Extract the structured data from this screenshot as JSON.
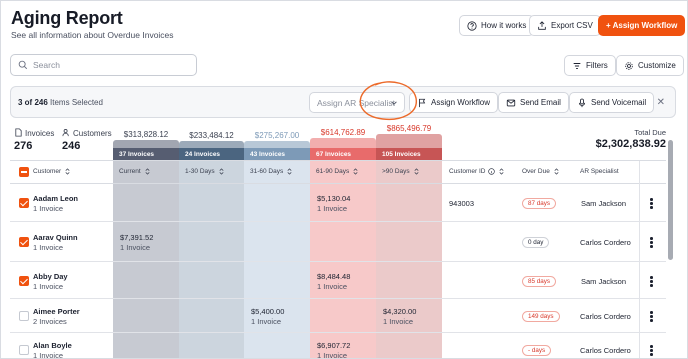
{
  "header": {
    "title": "Aging Report",
    "subtitle": "See all information about Overdue Invoices",
    "how_it_works": "How it works",
    "export_csv": "Export CSV",
    "assign_workflow": "+ Assign Workflow"
  },
  "search": {
    "placeholder": "Search"
  },
  "filters": {
    "filters_label": "Filters",
    "customize_label": "Customize"
  },
  "selection": {
    "count": "3 of 246",
    "suffix": "Items Selected",
    "ar_specialist_placeholder": "Assign AR Specialist",
    "assign_workflow": "Assign Workflow",
    "send_email": "Send Email",
    "send_voicemail": "Send Voicemail"
  },
  "stats": {
    "invoices_label": "Invoices",
    "invoices_value": "276",
    "customers_label": "Customers",
    "customers_value": "246",
    "total_due_label": "Total Due",
    "total_due_value": "$2,302,838.92"
  },
  "buckets": [
    {
      "amount": "$313,828.12",
      "invoices": "37 Invoices",
      "header": "Current",
      "color": "#565d71",
      "fill": "#c7cad2"
    },
    {
      "amount": "$233,484.12",
      "invoices": "24 Invoices",
      "header": "1-30 Days",
      "color": "#4b6580",
      "fill": "#ccd5de"
    },
    {
      "amount": "$275,267.00",
      "invoices": "43 Invoices",
      "header": "31-60 Days",
      "color": "#7d9ab7",
      "fill": "#dbe4ee"
    },
    {
      "amount": "$614,762.89",
      "invoices": "67 Invoices",
      "header": "61-90 Days",
      "color": "#e86b6b",
      "fill": "#f7c9c9"
    },
    {
      "amount": "$865,496.79",
      "invoices": "105 Invoices",
      "header": ">90 Days",
      "color": "#c75555",
      "fill": "#ebcaca"
    }
  ],
  "columns": {
    "customer": "Customer",
    "customer_id": "Customer ID",
    "over_due": "Over Due",
    "ar_specialist": "AR Specialist"
  },
  "rows": [
    {
      "name": "Aadam Leon",
      "invoices": "1 Invoice",
      "checked": true,
      "bucket": 3,
      "amount": "$5,130.04",
      "amount_sub": "1 Invoice",
      "customer_id": "943003",
      "overdue": "87 days",
      "overdue_style": "red",
      "specialist": "Sam Jackson"
    },
    {
      "name": "Aarav Quinn",
      "invoices": "1 Invoice",
      "checked": true,
      "bucket": 0,
      "amount": "$7,391.52",
      "amount_sub": "1 Invoice",
      "customer_id": "",
      "overdue": "0 day",
      "overdue_style": "gray",
      "specialist": "Carlos Cordero"
    },
    {
      "name": "Abby Day",
      "invoices": "1 Invoice",
      "checked": true,
      "bucket": 3,
      "amount": "$8,484.48",
      "amount_sub": "1 Invoice",
      "customer_id": "",
      "overdue": "85 days",
      "overdue_style": "red",
      "specialist": "Sam Jackson"
    },
    {
      "name": "Aimee Porter",
      "invoices": "2 Invoices",
      "checked": false,
      "bucket": 2,
      "amount": "$5,400.00",
      "amount_sub": "1 Invoice",
      "bucket2": 4,
      "amount2": "$4,320.00",
      "amount2_sub": "1 Invoice",
      "customer_id": "",
      "overdue": "149 days",
      "overdue_style": "red",
      "specialist": "Carlos Cordero"
    },
    {
      "name": "Alan Boyle",
      "invoices": "1 Invoice",
      "checked": false,
      "bucket": 3,
      "amount": "$6,907.72",
      "amount_sub": "1 Invoice",
      "customer_id": "",
      "overdue": "- days",
      "overdue_style": "red",
      "specialist": "Carlos Cordero"
    }
  ]
}
